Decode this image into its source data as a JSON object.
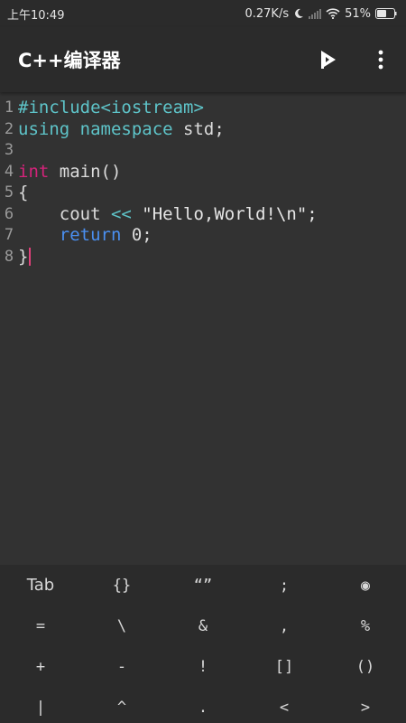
{
  "status_bar": {
    "time": "上午10:49",
    "speed": "0.27K/s",
    "battery": "51%"
  },
  "app_bar": {
    "title": "C++编译器",
    "run_icon": "run-icon",
    "more_icon": "more-vert-icon"
  },
  "editor": {
    "lines": [
      {
        "n": "1",
        "parts": [
          [
            "pre",
            "#include<iostream>"
          ]
        ]
      },
      {
        "n": "2",
        "parts": [
          [
            "kw",
            "using namespace"
          ],
          [
            "plain",
            " std;"
          ]
        ]
      },
      {
        "n": "3",
        "parts": []
      },
      {
        "n": "4",
        "parts": [
          [
            "type",
            "int"
          ],
          [
            "plain",
            " main()"
          ]
        ]
      },
      {
        "n": "5",
        "parts": [
          [
            "plain",
            "{"
          ]
        ]
      },
      {
        "n": "6",
        "parts": [
          [
            "plain",
            "    cout "
          ],
          [
            "op",
            "<<"
          ],
          [
            "str",
            " \"Hello,World!\\n\";"
          ]
        ]
      },
      {
        "n": "7",
        "parts": [
          [
            "plain",
            "    "
          ],
          [
            "ret",
            "return"
          ],
          [
            "plain",
            " 0;"
          ]
        ]
      },
      {
        "n": "8",
        "parts": [
          [
            "plain",
            "}"
          ],
          [
            "caret",
            ""
          ]
        ]
      }
    ]
  },
  "symbol_keys": [
    "Tab",
    "{}",
    "“”",
    ";",
    "◉",
    "=",
    "\\",
    "&",
    ",",
    "%",
    "+",
    "-",
    "!",
    "[]",
    "()",
    "|",
    "^",
    ".",
    "<",
    ">"
  ],
  "colors": {
    "background": "#323232",
    "bar": "#2b2b2b",
    "keyword": "#5ec4c9",
    "type": "#d4237a",
    "return": "#4a8ff0",
    "caret": "#e0407a"
  }
}
